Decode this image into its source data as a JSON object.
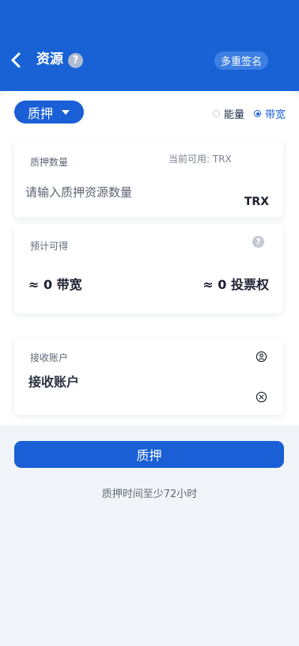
{
  "header": {
    "title": "资源",
    "help_icon": "question-icon",
    "multisig_label": "多重签名",
    "background_color": "#1862d6"
  },
  "controls": {
    "stake_select_label": "质押",
    "resource_options": [
      {
        "label": "能量",
        "selected": false
      },
      {
        "label": "带宽",
        "selected": true
      }
    ]
  },
  "stake_card": {
    "label": "质押数量",
    "available_text": "当前可用: TRX",
    "input_placeholder": "请输入质押资源数量",
    "unit": "TRX"
  },
  "estimate_card": {
    "label": "预计可得",
    "help_icon": "question-icon",
    "bandwidth_text": "≈ 0 带宽",
    "votes_text": "≈ 0 投票权"
  },
  "receiver_card": {
    "label": "接收账户",
    "input_placeholder": "接收账户",
    "address_book_icon": "address-book-icon",
    "clear_icon": "clear-icon"
  },
  "submit": {
    "label": "质押",
    "accent_color": "#1a5fd6"
  },
  "footnote": "质押时间至少72小时"
}
